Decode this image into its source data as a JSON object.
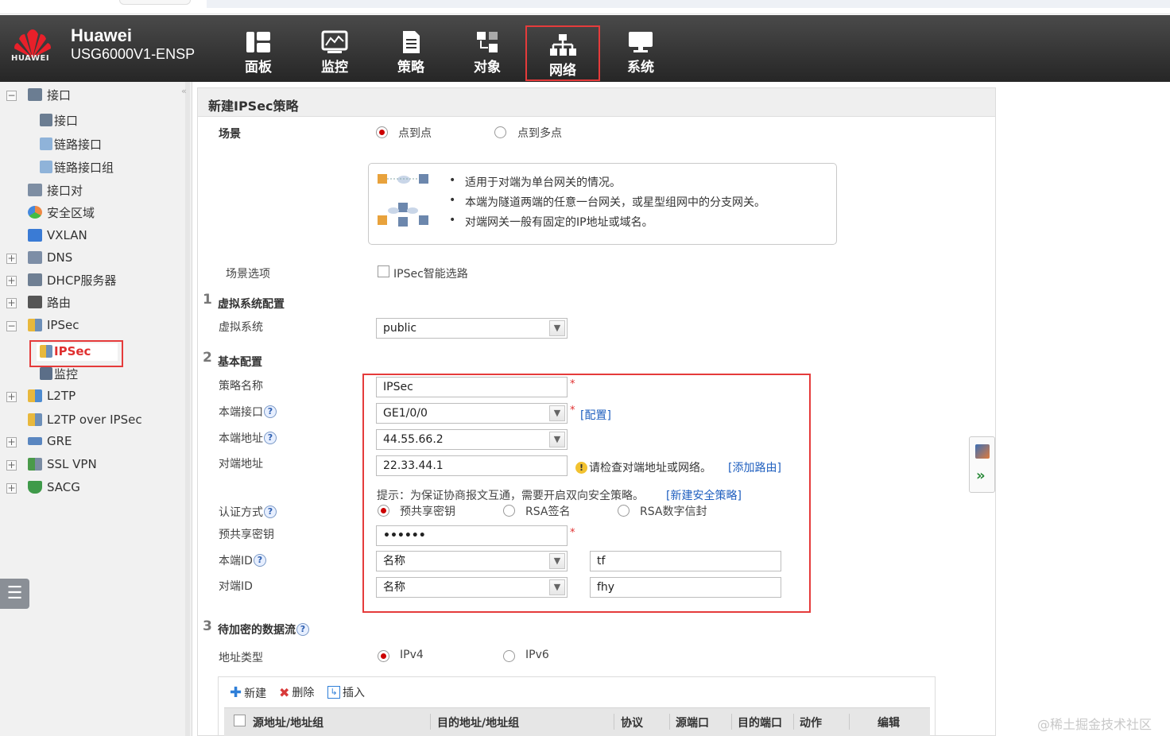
{
  "brand": {
    "name": "Huawei",
    "model": "USG6000V1-ENSP",
    "logo_text": "HUAWEI"
  },
  "nav": [
    {
      "label": "面板",
      "icon": "dashboard-icon"
    },
    {
      "label": "监控",
      "icon": "monitor-icon"
    },
    {
      "label": "策略",
      "icon": "policy-icon"
    },
    {
      "label": "对象",
      "icon": "object-icon"
    },
    {
      "label": "网络",
      "icon": "network-icon",
      "active": true
    },
    {
      "label": "系统",
      "icon": "system-icon"
    }
  ],
  "sidebar": {
    "items": [
      {
        "label": "接口",
        "expanded": true
      },
      {
        "label": "接口"
      },
      {
        "label": "链路接口"
      },
      {
        "label": "链路接口组"
      },
      {
        "label": "接口对"
      },
      {
        "label": "安全区域"
      },
      {
        "label": "VXLAN"
      },
      {
        "label": "DNS"
      },
      {
        "label": "DHCP服务器"
      },
      {
        "label": "路由"
      },
      {
        "label": "IPSec",
        "expanded": true
      },
      {
        "label": "IPSec",
        "selected": true
      },
      {
        "label": "监控"
      },
      {
        "label": "L2TP"
      },
      {
        "label": "L2TP over IPSec"
      },
      {
        "label": "GRE"
      },
      {
        "label": "SSL VPN"
      },
      {
        "label": "SACG"
      }
    ],
    "toggle_icon": "list-menu-icon"
  },
  "form": {
    "title": "新建IPSec策略",
    "scene": {
      "label": "场景",
      "options": [
        "点到点",
        "点到多点"
      ],
      "selected": "点到点",
      "info": [
        "适用于对端为单台网关的情况。",
        "本端为隧道两端的任意一台网关，或星型组网中的分支网关。",
        "对端网关一般有固定的IP地址或域名。"
      ]
    },
    "scene_option": {
      "label": "场景选项",
      "checkbox": "IPSec智能选路",
      "checked": false
    },
    "section1": {
      "num": "1",
      "title": "虚拟系统配置",
      "vsys_label": "虚拟系统",
      "vsys_value": "public"
    },
    "section2": {
      "num": "2",
      "title": "基本配置",
      "policy_name_label": "策略名称",
      "policy_name": "IPSec",
      "local_if_label": "本端接口",
      "local_if": "GE1/0/0",
      "config_link": "[配置]",
      "local_addr_label": "本端地址",
      "local_addr": "44.55.66.2",
      "peer_addr_label": "对端地址",
      "peer_addr": "22.33.44.1",
      "peer_hint": "请检查对端地址或网络。",
      "add_route_link": "[添加路由]",
      "tip": "提示：为保证协商报文互通，需要开启双向安全策略。",
      "new_policy_link": "[新建安全策略]",
      "auth_label": "认证方式",
      "auth_options": [
        "预共享密钥",
        "RSA签名",
        "RSA数字信封"
      ],
      "auth_selected": "预共享密钥",
      "psk_label": "预共享密钥",
      "psk_value": "••••••",
      "local_id_label": "本端ID",
      "local_id_type": "名称",
      "local_id_value": "tf",
      "peer_id_label": "对端ID",
      "peer_id_type": "名称",
      "peer_id_value": "fhy",
      "required_mark": "*",
      "help_mark": "?"
    },
    "section3": {
      "num": "3",
      "title": "待加密的数据流",
      "addr_type_label": "地址类型",
      "addr_types": [
        "IPv4",
        "IPv6"
      ],
      "addr_selected": "IPv4",
      "toolbar": [
        "新建",
        "删除",
        "插入"
      ],
      "columns": [
        "源地址/地址组",
        "目的地址/地址组",
        "协议",
        "源端口",
        "目的端口",
        "动作",
        "编辑"
      ]
    }
  },
  "watermark": "@稀土掘金技术社区",
  "colors": {
    "accent_red": "#e53b3b",
    "link_blue": "#1f5fbf",
    "topbar": "#333333"
  }
}
